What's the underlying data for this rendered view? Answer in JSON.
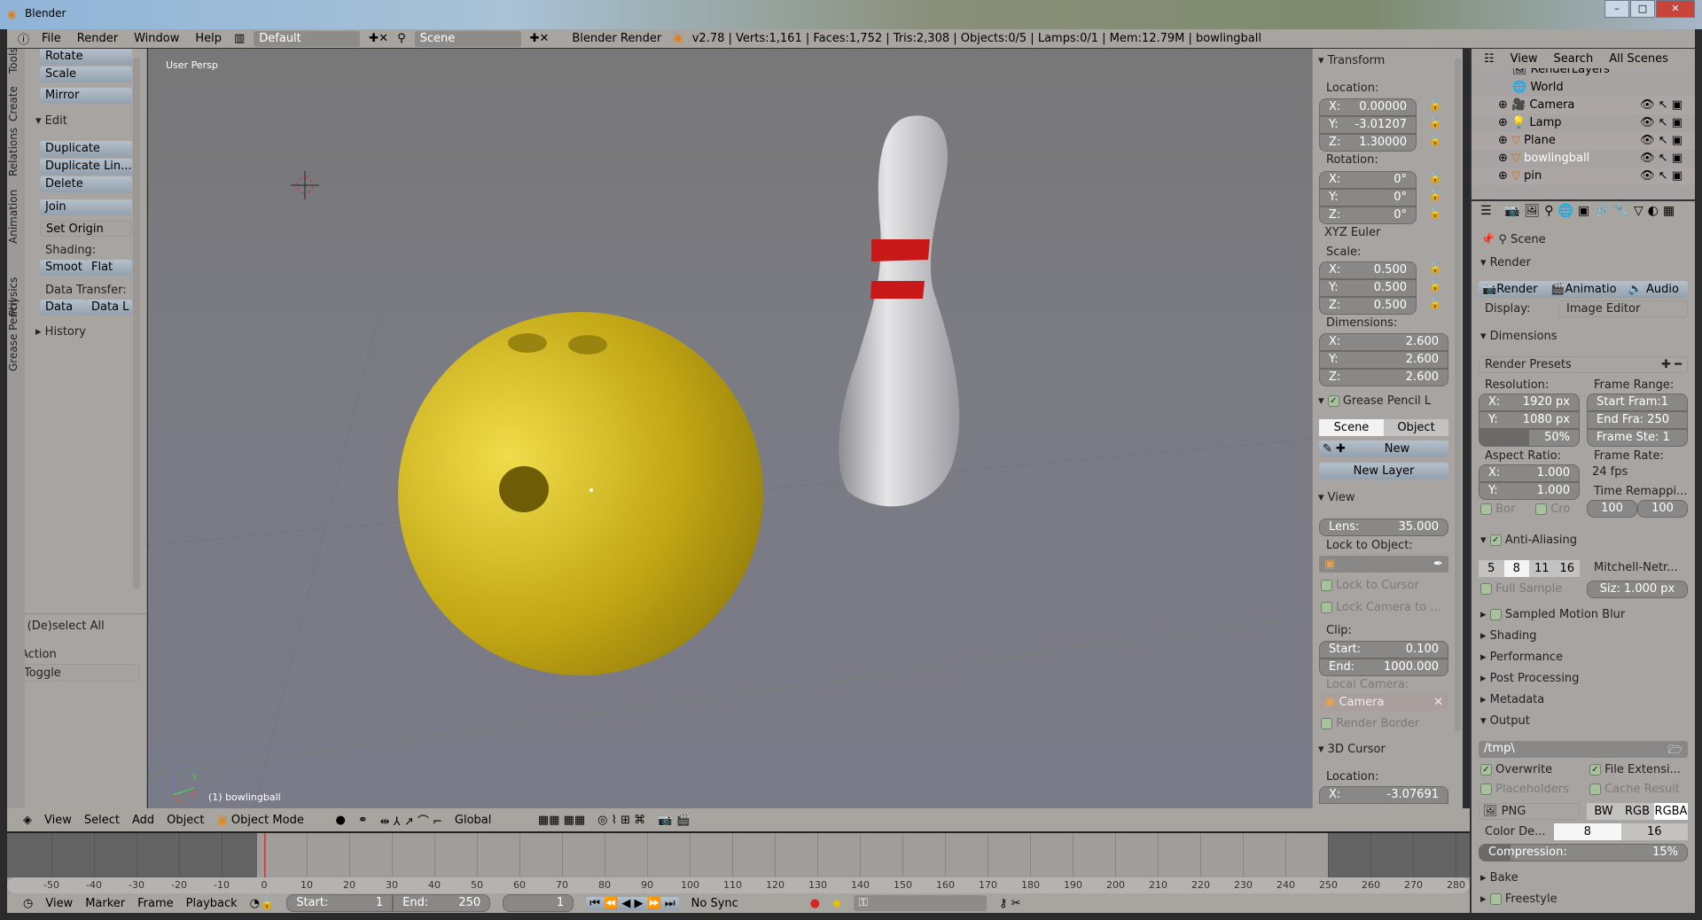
{
  "window": {
    "title": "Blender",
    "min": "–",
    "max": "□",
    "close": "✕"
  },
  "topbar": {
    "menus": [
      "File",
      "Render",
      "Window",
      "Help"
    ],
    "layout": "Default",
    "scene": "Scene",
    "engine": "Blender Render",
    "stats": "v2.78 | Verts:1,161 | Faces:1,752 | Tris:2,308 | Objects:0/5 | Lamps:0/1 | Mem:12.79M | bowlingball"
  },
  "tools": {
    "tabs": [
      "Tools",
      "Create",
      "Relations",
      "Animation",
      "Physics",
      "Grease Pencil"
    ],
    "buttons_top": [
      "Rotate",
      "Scale",
      "Mirror"
    ],
    "edit_header": "Edit",
    "edit_buttons": [
      "Duplicate",
      "Duplicate Lin...",
      "Delete",
      "Join"
    ],
    "set_origin": "Set Origin",
    "shading_label": "Shading:",
    "shading": [
      "Smoot",
      "Flat"
    ],
    "data_transfer_label": "Data Transfer:",
    "data_transfer": [
      "Data",
      "Data L"
    ],
    "history": "History",
    "operator": {
      "title": "(De)select All",
      "action_label": "Action",
      "action_value": "Toggle"
    }
  },
  "viewport": {
    "view_label": "User Persp",
    "object_label": "(1) bowlingball",
    "axes": [
      "X",
      "Y",
      "Z"
    ],
    "ball_color": "#c9b11a",
    "pin_stripe": "#c81818"
  },
  "npanel": {
    "transform": "Transform",
    "location_label": "Location:",
    "location": [
      [
        "X:",
        "0.00000"
      ],
      [
        "Y:",
        "-3.01207"
      ],
      [
        "Z:",
        "1.30000"
      ]
    ],
    "rotation_label": "Rotation:",
    "rotation": [
      [
        "X:",
        "0°"
      ],
      [
        "Y:",
        "0°"
      ],
      [
        "Z:",
        "0°"
      ]
    ],
    "rotation_mode": "XYZ Euler",
    "scale_label": "Scale:",
    "scale": [
      [
        "X:",
        "0.500"
      ],
      [
        "Y:",
        "0.500"
      ],
      [
        "Z:",
        "0.500"
      ]
    ],
    "dimensions_label": "Dimensions:",
    "dimensions": [
      [
        "X:",
        "2.600"
      ],
      [
        "Y:",
        "2.600"
      ],
      [
        "Z:",
        "2.600"
      ]
    ],
    "grease_pencil": "Grease Pencil L",
    "gp_tabs": [
      "Scene",
      "Object"
    ],
    "gp_new": "New",
    "gp_new_layer": "New Layer",
    "view": "View",
    "lens_label": "Lens:",
    "lens": "35.000",
    "lock_object_label": "Lock to Object:",
    "lock_cursor": "Lock to Cursor",
    "lock_camera": "Lock Camera to ...",
    "clip_label": "Clip:",
    "clip_start_label": "Start:",
    "clip_start": "0.100",
    "clip_end_label": "End:",
    "clip_end": "1000.000",
    "local_camera_label": "Local Camera:",
    "local_camera": "Camera",
    "render_border": "Render Border",
    "cursor": "3D Cursor",
    "cursor_location_label": "Location:",
    "cursor_x_label": "X:",
    "cursor_x": "-3.07691"
  },
  "outliner": {
    "menus": [
      "View",
      "Search"
    ],
    "filter": "All Scenes",
    "items": [
      "RenderLayers",
      "World",
      "Camera",
      "Lamp",
      "Plane",
      "bowlingball",
      "pin"
    ]
  },
  "props": {
    "scene": "Scene",
    "render": "Render",
    "render_buttons": [
      "Render",
      "Animatio",
      "Audio"
    ],
    "display_label": "Display:",
    "display_value": "Image Editor",
    "dimensions": "Dimensions",
    "presets": "Render Presets",
    "resolution_label": "Resolution:",
    "res_x": [
      "X:",
      "1920 px"
    ],
    "res_y": [
      "Y:",
      "1080 px"
    ],
    "res_pct": "50%",
    "res_pct_value": 50,
    "frame_range_label": "Frame Range:",
    "frame_start": "Start Fram:1",
    "frame_end": "End Fra: 250",
    "frame_step": "Frame Ste: 1",
    "aspect_label": "Aspect Ratio:",
    "aspect_x": [
      "X:",
      "1.000"
    ],
    "aspect_y": [
      "Y:",
      "1.000"
    ],
    "frame_rate_label": "Frame Rate:",
    "frame_rate": "24 fps",
    "border": "Bor",
    "crop": "Cro",
    "time_remap_label": "Time Remappi...",
    "remap_old": "100",
    "remap_new": "100",
    "aa": "Anti-Aliasing",
    "aa_samples": [
      "5",
      "8",
      "11",
      "16"
    ],
    "aa_filter": "Mitchell-Netr...",
    "full_sample": "Full Sample",
    "aa_size": "Siz: 1.000 px",
    "collapsed": [
      "Sampled Motion Blur",
      "Shading",
      "Performance",
      "Post Processing",
      "Metadata"
    ],
    "output": "Output",
    "output_path": "/tmp\\",
    "overwrite": "Overwrite",
    "file_ext": "File Extensi...",
    "placeholders": "Placeholders",
    "cache": "Cache Result",
    "format": "PNG",
    "color_modes": [
      "BW",
      "RGB",
      "RGBA"
    ],
    "color_depth_label": "Color De...",
    "depths": [
      "8",
      "16"
    ],
    "compression": "Compression:",
    "compression_value": "15%",
    "compression_pct": 15,
    "bake": "Bake",
    "freestyle": "Freestyle"
  },
  "header3d": {
    "menus": [
      "View",
      "Select",
      "Add",
      "Object"
    ],
    "mode": "Object Mode",
    "orientation": "Global"
  },
  "timeline": {
    "ticks": [
      "-50",
      "-40",
      "-30",
      "-20",
      "-10",
      "0",
      "10",
      "20",
      "30",
      "40",
      "50",
      "60",
      "70",
      "80",
      "90",
      "100",
      "110",
      "120",
      "130",
      "140",
      "150",
      "160",
      "170",
      "180",
      "190",
      "200",
      "210",
      "220",
      "230",
      "240",
      "250",
      "260",
      "270",
      "280"
    ],
    "current_frame": 1
  },
  "tlheader": {
    "menus": [
      "View",
      "Marker",
      "Frame",
      "Playback"
    ],
    "start_label": "Start:",
    "start": "1",
    "end_label": "End:",
    "end": "250",
    "frame": "1",
    "sync": "No Sync"
  }
}
